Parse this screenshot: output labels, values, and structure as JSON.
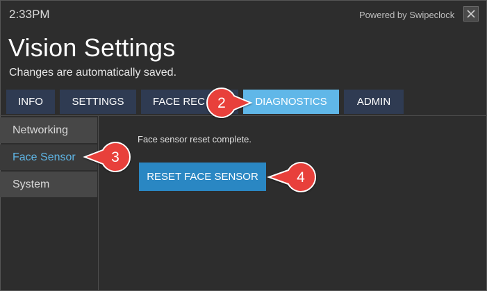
{
  "header": {
    "time": "2:33PM",
    "powered_by": "Powered by Swipeclock",
    "close_label": "✕"
  },
  "page": {
    "title": "Vision Settings",
    "subtitle": "Changes are automatically saved."
  },
  "tabs": [
    {
      "label": "INFO"
    },
    {
      "label": "SETTINGS"
    },
    {
      "label": "FACE REC"
    },
    {
      "label": "DIAGNOSTICS",
      "active": true
    },
    {
      "label": "ADMIN"
    }
  ],
  "sidebar": {
    "items": [
      {
        "label": "Networking"
      },
      {
        "label": "Face Sensor",
        "active": true
      },
      {
        "label": "System"
      }
    ]
  },
  "main": {
    "status_text": "Face sensor reset complete.",
    "reset_button_label": "RESET FACE SENSOR"
  },
  "callouts": {
    "tab_step": "2",
    "sidebar_step": "3",
    "button_step": "4"
  },
  "colors": {
    "background": "#2d2d2d",
    "tab": "#2f3b52",
    "tab_active": "#60b7e8",
    "sidebar_active_text": "#5fb6e6",
    "button": "#2a87c3",
    "callout": "#e8413b"
  }
}
